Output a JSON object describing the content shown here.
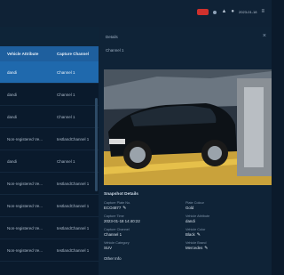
{
  "topbar": {
    "badge_color": "#d0312d",
    "icons": [
      "alert-badge",
      "dot",
      "bell-icon",
      "user-icon",
      "settings-icon"
    ],
    "time_text": "2023-01-18",
    "menu_label": "≡"
  },
  "left_panel": {
    "columns": [
      "Vehicle Attribute",
      "Capture Channel"
    ],
    "rows": [
      {
        "attr": "dandi",
        "channel": "Channel 1",
        "selected": true
      },
      {
        "attr": "dandi",
        "channel": "Channel 1",
        "selected": false
      },
      {
        "attr": "dandi",
        "channel": "Channel 1",
        "selected": false
      },
      {
        "attr": "Non-registered Ve...",
        "channel": "testlandChannel 1",
        "selected": false
      },
      {
        "attr": "dandi",
        "channel": "Channel 1",
        "selected": false
      },
      {
        "attr": "Non-registered Ve...",
        "channel": "testlandChannel 1",
        "selected": false
      },
      {
        "attr": "Non-registered Ve...",
        "channel": "testlandChannel 1",
        "selected": false
      },
      {
        "attr": "Non-registered Ve...",
        "channel": "testlandChannel 1",
        "selected": false
      },
      {
        "attr": "Non-registered Ve...",
        "channel": "testlandChannel 1",
        "selected": false
      }
    ]
  },
  "right_panel": {
    "title": "Details",
    "channel": "Channel 1",
    "snapshot_title": "Snapshot Details",
    "fields_left": [
      {
        "label": "Capture Plate No.",
        "value": "ECO4877",
        "editable": true
      },
      {
        "label": "Capture Time",
        "value": "2023-01-18 14:40:22",
        "editable": false
      },
      {
        "label": "Capture Channel",
        "value": "Channel 1",
        "editable": false
      },
      {
        "label": "Vehicle Category",
        "value": "SUV",
        "editable": false
      }
    ],
    "fields_right": [
      {
        "label": "Plate Colour",
        "value": "Gold",
        "editable": false
      },
      {
        "label": "Vehicle Attribute",
        "value": "dandi",
        "editable": false
      },
      {
        "label": "Vehicle Color",
        "value": "Black",
        "editable": true
      },
      {
        "label": "Vehicle Brand",
        "value": "Mercedes",
        "editable": true
      }
    ],
    "other_info": "Other Info",
    "close_icon": "×"
  }
}
